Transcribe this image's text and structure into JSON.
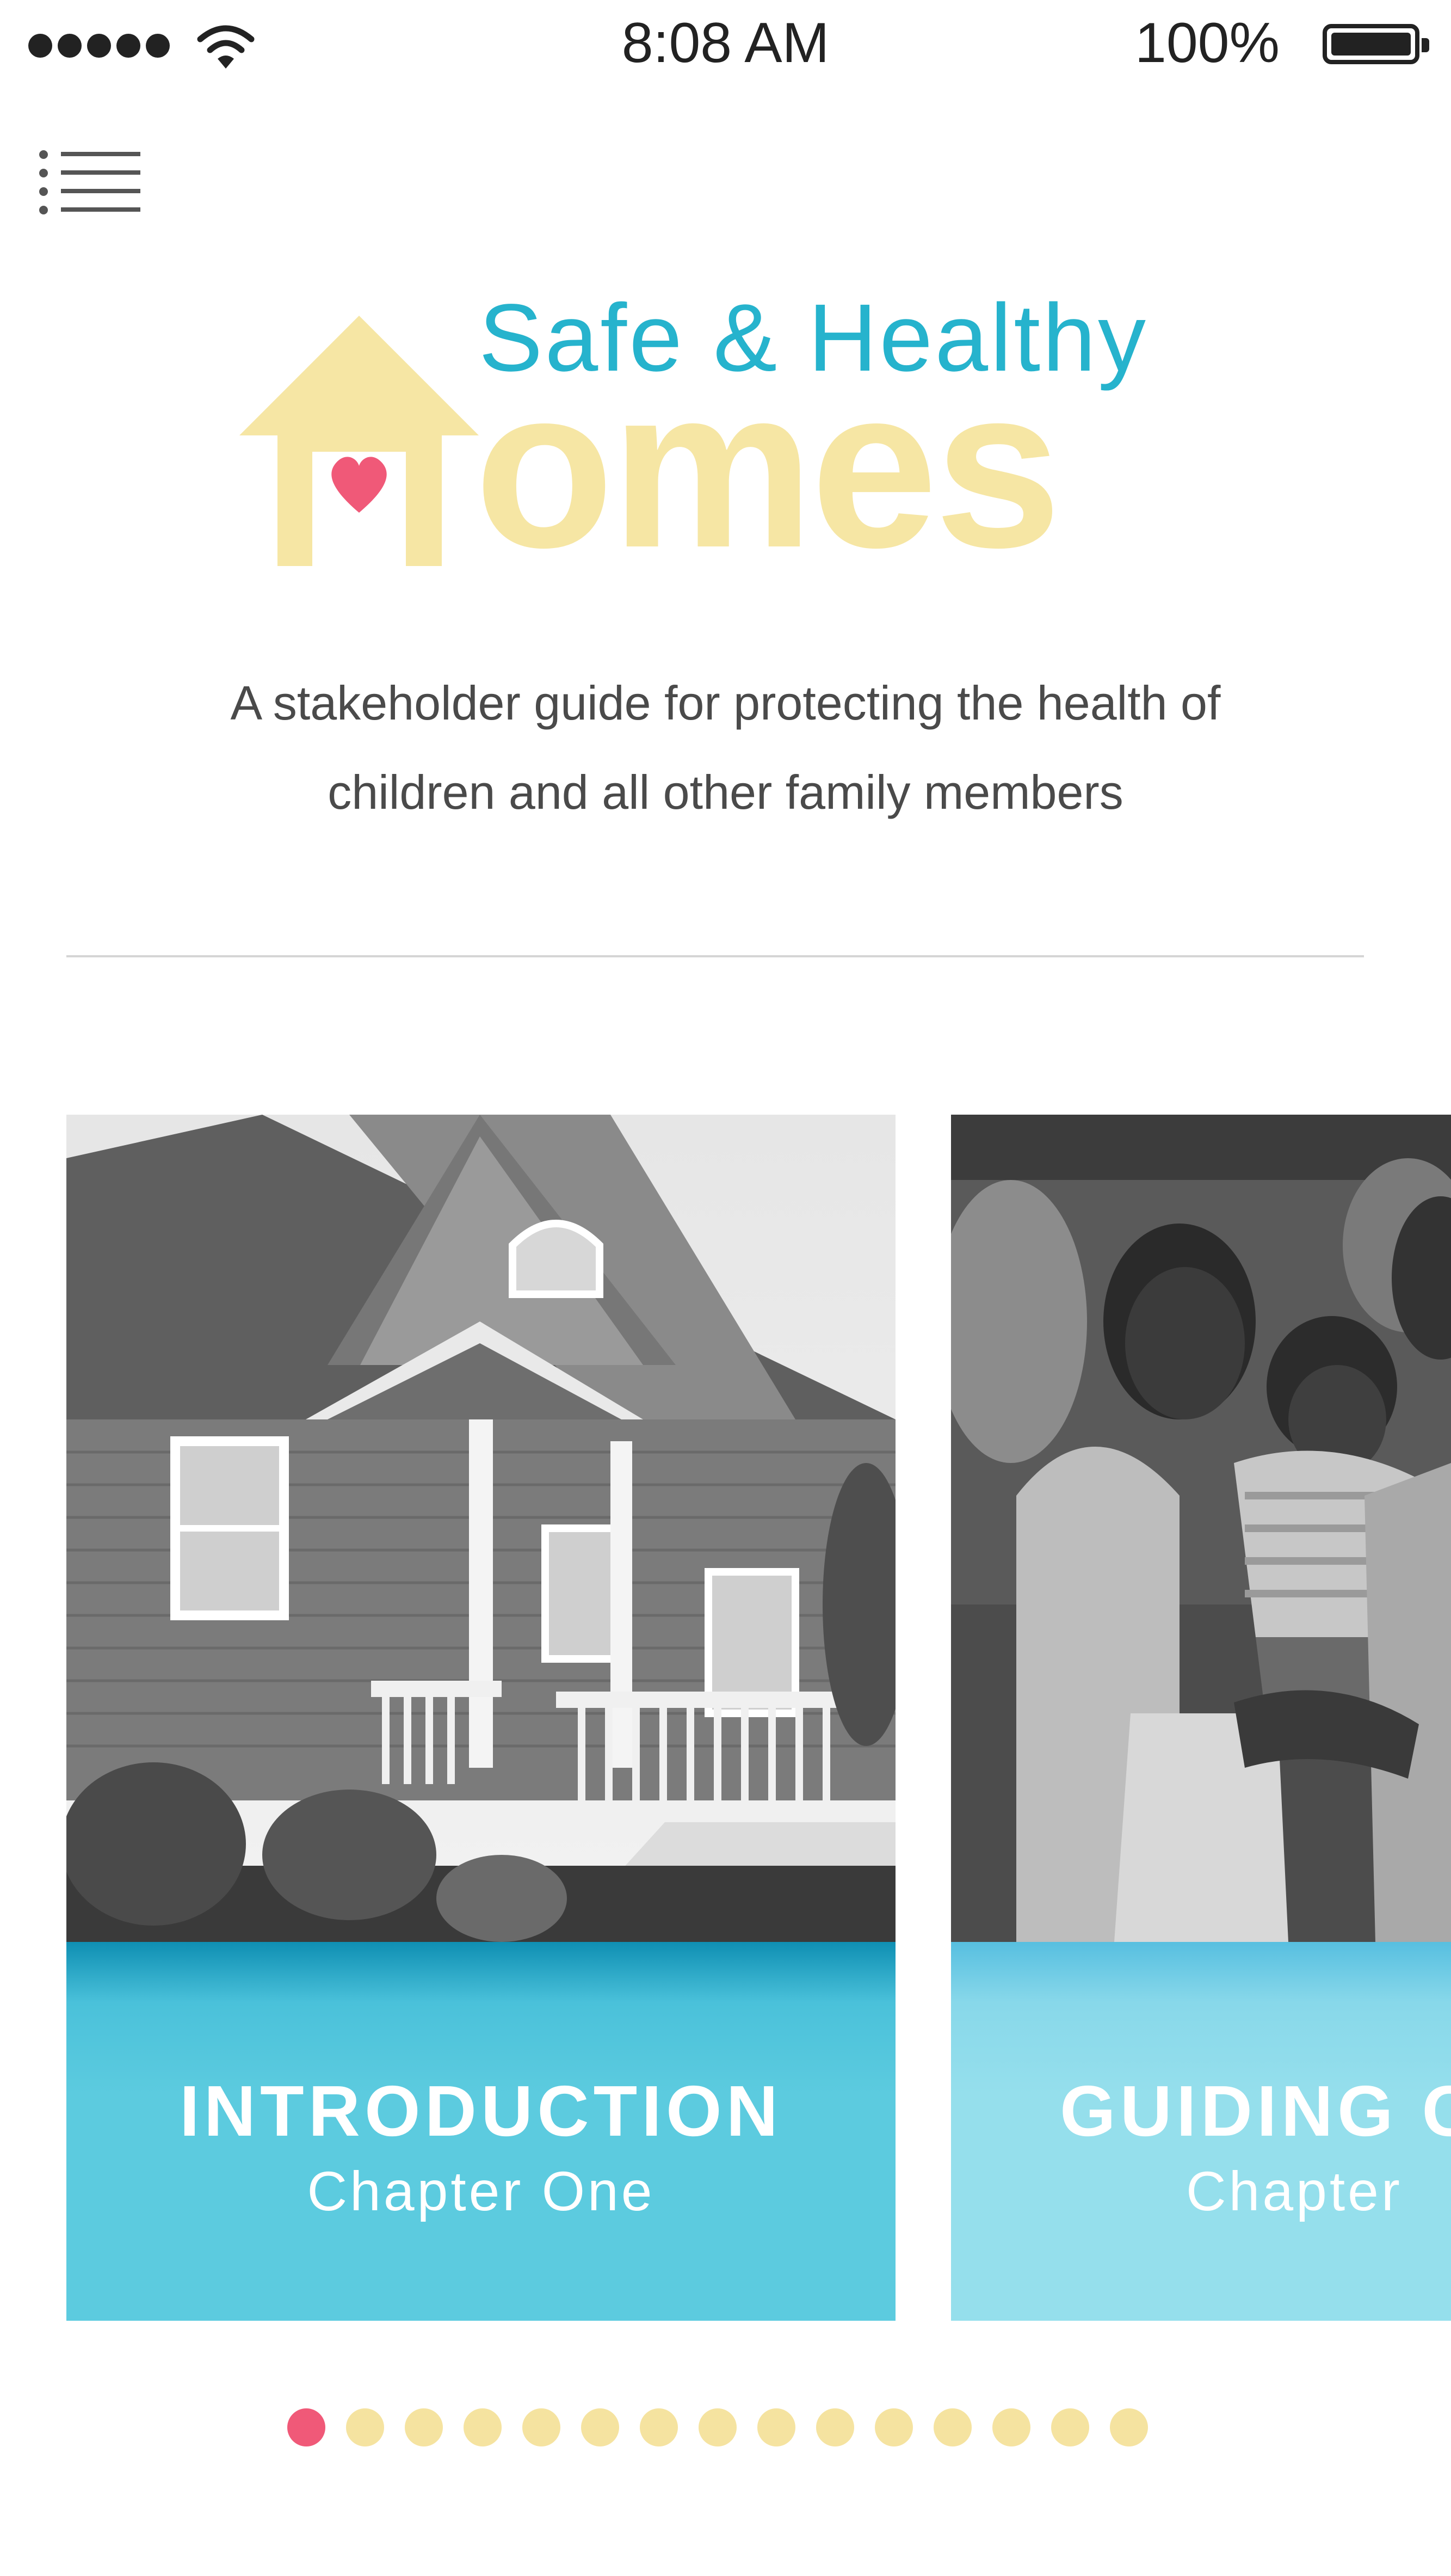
{
  "status_bar": {
    "time": "8:08 AM",
    "battery": "100%",
    "signal_bars": 5,
    "wifi_icon": "wifi-icon",
    "battery_icon": "battery-icon"
  },
  "header": {
    "menu_icon": "menu-list-icon"
  },
  "logo": {
    "line1": "Safe & Healthy",
    "line2": "omes",
    "house_icon": "house-heart-icon",
    "colors": {
      "line1": "#26b3cd",
      "line2": "#f6e6a4",
      "heart": "#f05978"
    }
  },
  "subtitle": {
    "line1": "A stakeholder guide for protecting the health of",
    "line2": "children and all other family members"
  },
  "cards": [
    {
      "title": "INTRODUCTION",
      "subtitle": "Chapter One",
      "image": "house-photo"
    },
    {
      "title": "GUIDING C",
      "subtitle": "Chapter",
      "image": "family-photo"
    }
  ],
  "pagination": {
    "total": 15,
    "active": 1
  },
  "colors": {
    "accent": "#5ccbdf",
    "pager_active": "#f05978",
    "pager_inactive": "#f5e3a0"
  }
}
